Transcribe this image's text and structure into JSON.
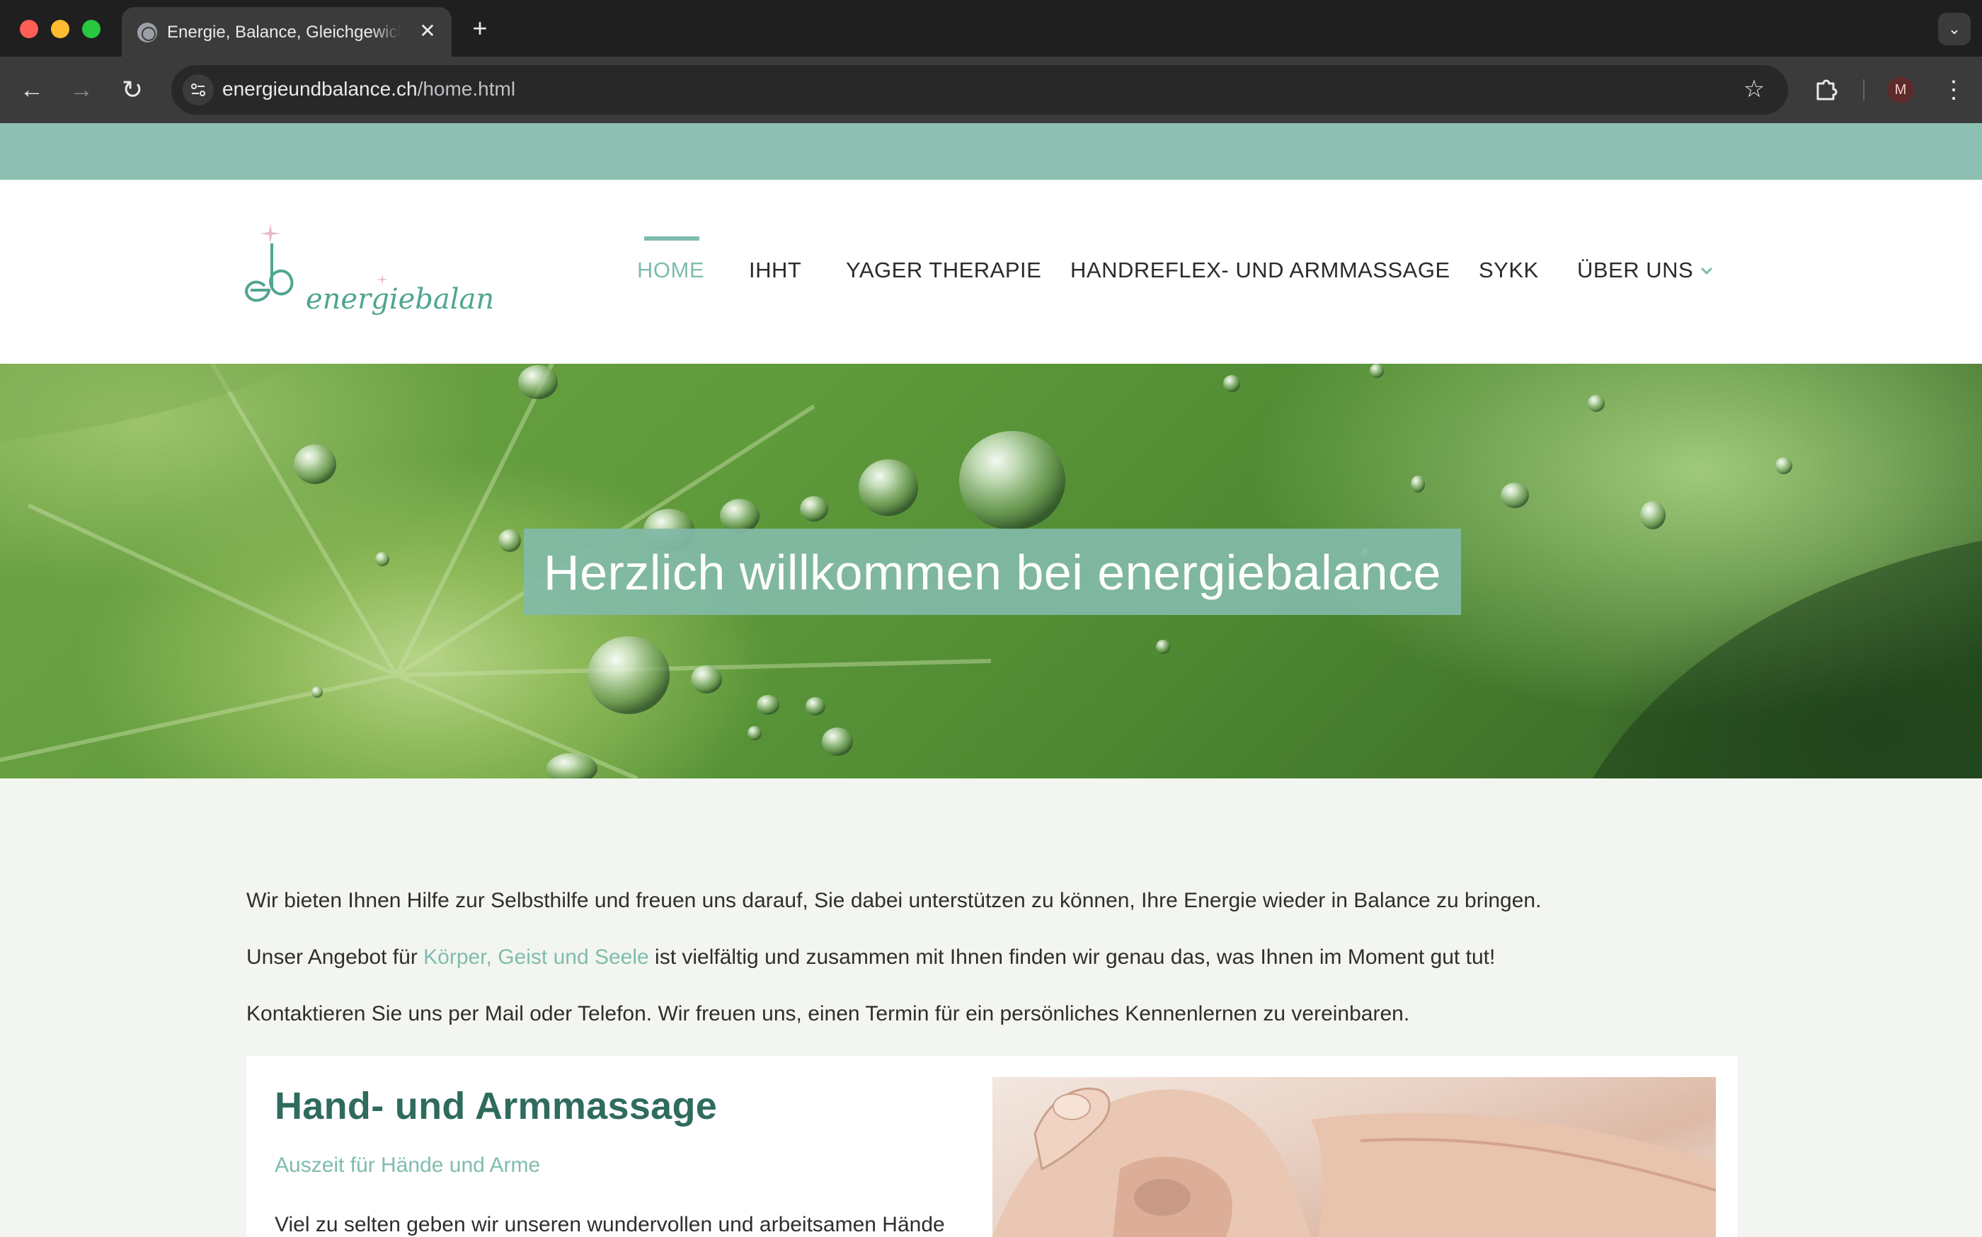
{
  "browser": {
    "tab_title": "Energie, Balance, Gleichgewicht",
    "tab_close": "✕",
    "new_tab": "+",
    "tab_menu": "⌄",
    "url_domain": "energieundbalance.ch",
    "url_path": "/home.html",
    "avatar_letter": "M",
    "back_glyph": "←",
    "forward_glyph": "→",
    "reload_glyph": "↻",
    "star_glyph": "☆",
    "menu_glyph": "⋮"
  },
  "site": {
    "logo_text": "energiebalance",
    "nav": [
      {
        "label": "HOME",
        "active": true
      },
      {
        "label": "IHHT"
      },
      {
        "label": "YAGER THERAPIE"
      },
      {
        "label": "HANDREFLEX- UND ARMMASSAGE"
      },
      {
        "label": "SYKK"
      },
      {
        "label": "ÜBER UNS",
        "has_dropdown": true
      }
    ],
    "hero_title": "Herzlich willkommen bei energiebalance",
    "intro": {
      "p1": "Wir bieten Ihnen Hilfe zur Selbsthilfe und freuen uns darauf, Sie dabei unterstützen zu können, Ihre Energie wieder in Balance zu bringen.",
      "p2_before": "Unser Angebot für ",
      "p2_link": "Körper, Geist und Seele",
      "p2_after": " ist vielfältig und zusammen mit Ihnen finden wir genau das, was Ihnen im Moment gut tut!",
      "p3": "Kontaktieren Sie uns per Mail oder Telefon. Wir freuen uns, einen Termin für ein persönliches Kennenlernen zu vereinbaren."
    },
    "card": {
      "title": "Hand- und Armmassage",
      "subtitle": "Auszeit für Hände und Arme",
      "text": "Viel zu selten geben wir unseren wundervollen und arbeitsamen Hände"
    }
  },
  "colors": {
    "accent": "#7fbcae",
    "teal_strip": "#8cbfb1",
    "heading": "#2f6b5e"
  }
}
